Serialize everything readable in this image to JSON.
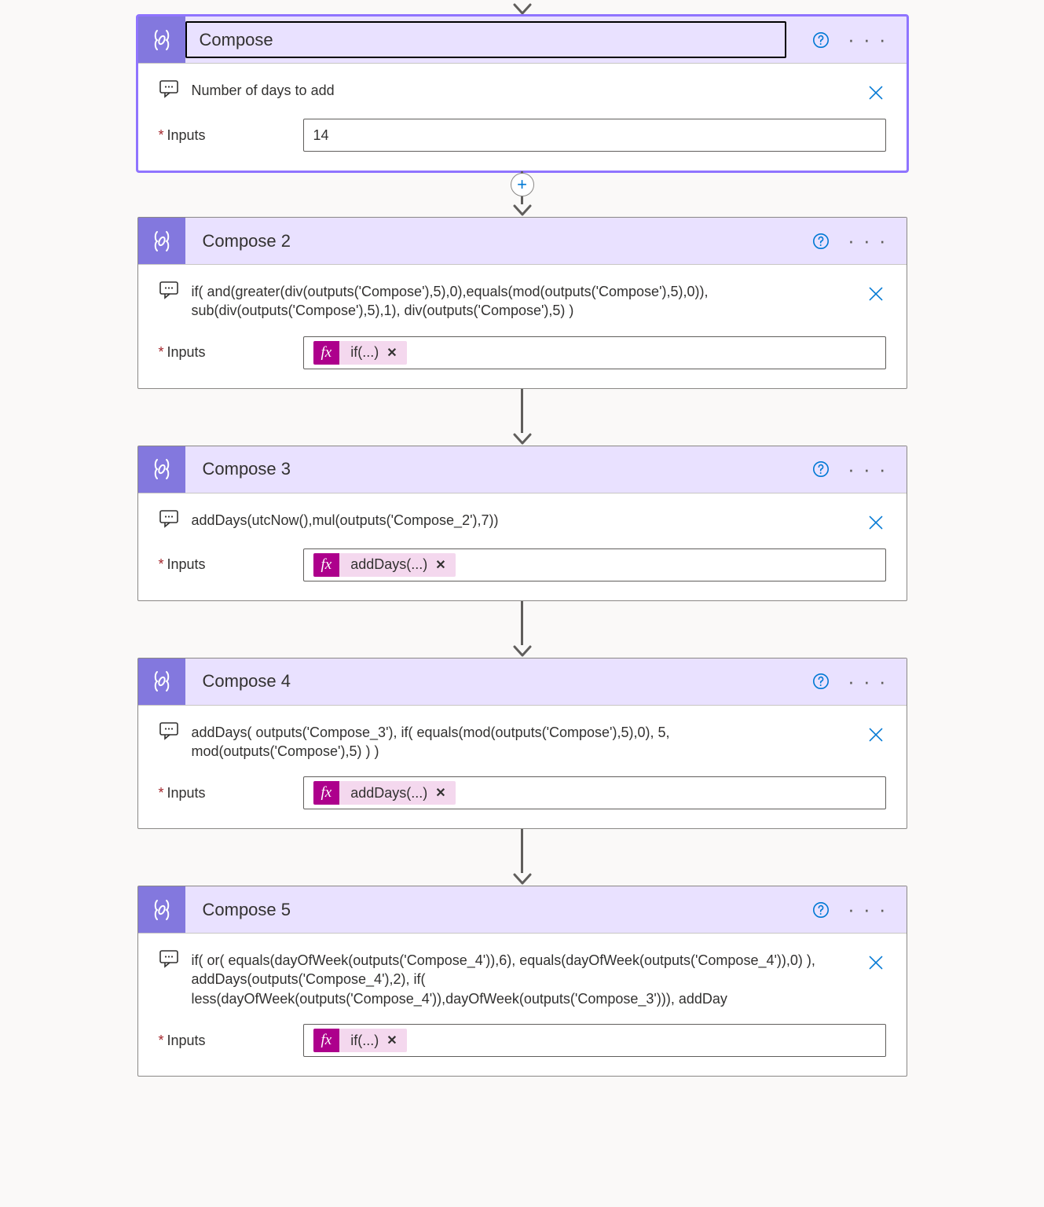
{
  "cards": [
    {
      "title": "Compose",
      "comment": "Number of days to add",
      "inputLabel": "Inputs",
      "plainValue": "14",
      "selected": true,
      "insertAfter": true
    },
    {
      "title": "Compose 2",
      "comment": "if( and(greater(div(outputs('Compose'),5),0),equals(mod(outputs('Compose'),5),0)), sub(div(outputs('Compose'),5),1), div(outputs('Compose'),5) )",
      "inputLabel": "Inputs",
      "tokenText": "if(...)"
    },
    {
      "title": "Compose 3",
      "comment": "addDays(utcNow(),mul(outputs('Compose_2'),7))",
      "inputLabel": "Inputs",
      "tokenText": "addDays(...)"
    },
    {
      "title": "Compose 4",
      "comment": "addDays( outputs('Compose_3'), if( equals(mod(outputs('Compose'),5),0), 5, mod(outputs('Compose'),5) ) )",
      "inputLabel": "Inputs",
      "tokenText": "addDays(...)"
    },
    {
      "title": "Compose 5",
      "comment": "if( or( equals(dayOfWeek(outputs('Compose_4')),6), equals(dayOfWeek(outputs('Compose_4')),0) ), addDays(outputs('Compose_4'),2), if( less(dayOfWeek(outputs('Compose_4')),dayOfWeek(outputs('Compose_3'))), addDay",
      "inputLabel": "Inputs",
      "tokenText": "if(...)"
    }
  ],
  "fxLabel": "fx",
  "requiredMark": "*"
}
